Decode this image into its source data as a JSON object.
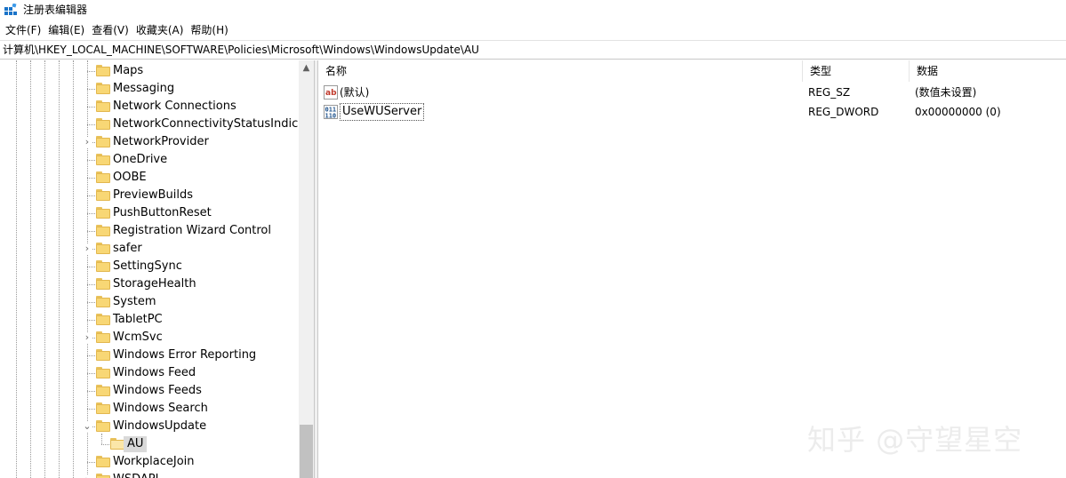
{
  "window": {
    "title": "注册表编辑器",
    "icon": "regedit-icon"
  },
  "menu": [
    {
      "label": "文件(F)"
    },
    {
      "label": "编辑(E)"
    },
    {
      "label": "查看(V)"
    },
    {
      "label": "收藏夹(A)"
    },
    {
      "label": "帮助(H)"
    }
  ],
  "address": "计算机\\HKEY_LOCAL_MACHINE\\SOFTWARE\\Policies\\Microsoft\\Windows\\WindowsUpdate\\AU",
  "tree": [
    {
      "label": "Maps",
      "expander": ""
    },
    {
      "label": "Messaging",
      "expander": ""
    },
    {
      "label": "Network Connections",
      "expander": ""
    },
    {
      "label": "NetworkConnectivityStatusIndicator",
      "expander": ""
    },
    {
      "label": "NetworkProvider",
      "expander": "›"
    },
    {
      "label": "OneDrive",
      "expander": ""
    },
    {
      "label": "OOBE",
      "expander": ""
    },
    {
      "label": "PreviewBuilds",
      "expander": ""
    },
    {
      "label": "PushButtonReset",
      "expander": ""
    },
    {
      "label": "Registration Wizard Control",
      "expander": ""
    },
    {
      "label": "safer",
      "expander": "›"
    },
    {
      "label": "SettingSync",
      "expander": ""
    },
    {
      "label": "StorageHealth",
      "expander": ""
    },
    {
      "label": "System",
      "expander": ""
    },
    {
      "label": "TabletPC",
      "expander": ""
    },
    {
      "label": "WcmSvc",
      "expander": "›"
    },
    {
      "label": "Windows Error Reporting",
      "expander": ""
    },
    {
      "label": "Windows Feed",
      "expander": ""
    },
    {
      "label": "Windows Feeds",
      "expander": ""
    },
    {
      "label": "Windows Search",
      "expander": ""
    },
    {
      "label": "WindowsUpdate",
      "expander": "⌄"
    },
    {
      "label": "AU",
      "expander": "",
      "child": true,
      "selected": true
    },
    {
      "label": "WorkplaceJoin",
      "expander": ""
    },
    {
      "label": "WSDAPI",
      "expander": "›"
    }
  ],
  "columns": {
    "name": "名称",
    "type": "类型",
    "data": "数据"
  },
  "values": [
    {
      "name": "(默认)",
      "type": "REG_SZ",
      "data": "(数值未设置)",
      "icon": "string-value-icon"
    },
    {
      "name": "UseWUServer",
      "type": "REG_DWORD",
      "data": "0x00000000 (0)",
      "icon": "binary-value-icon"
    }
  ],
  "watermark": "知乎 @守望星空",
  "colors": {
    "folder": "#f8d775",
    "selection": "#d9d9d9",
    "icon_blue": "#1a73c8"
  }
}
